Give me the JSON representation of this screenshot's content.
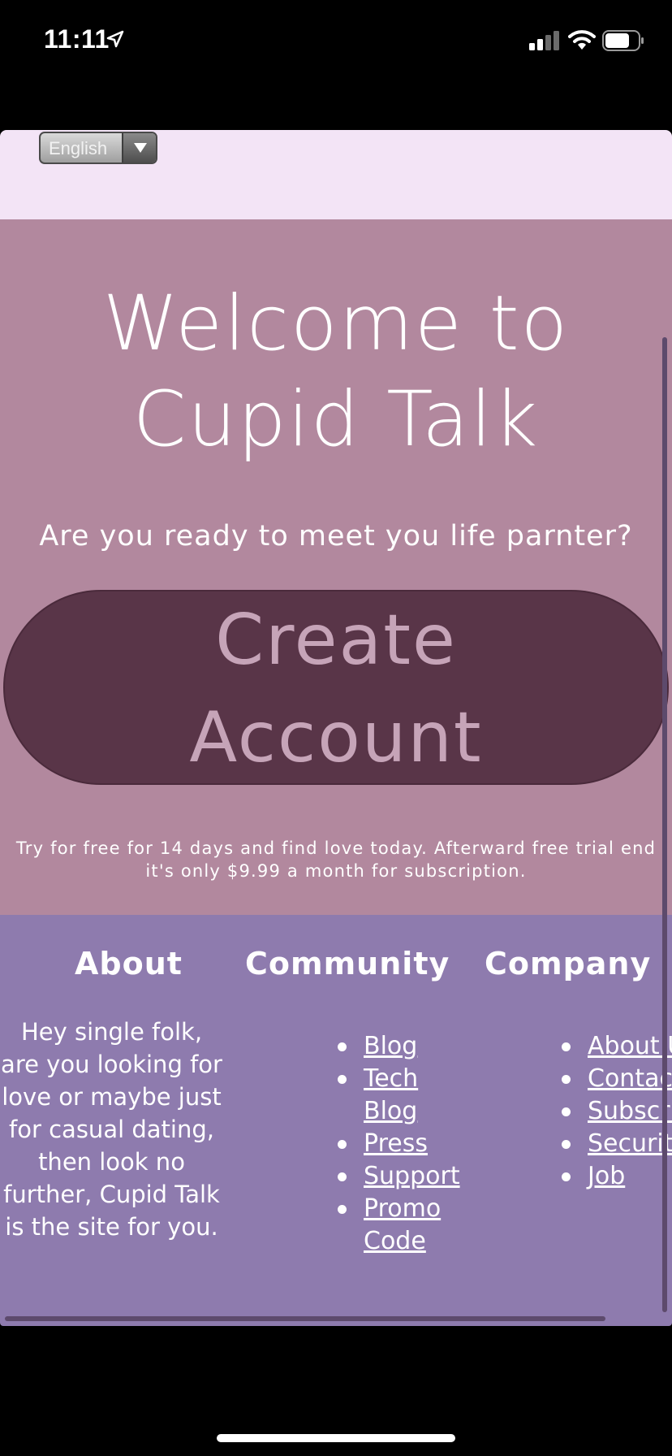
{
  "status": {
    "time": "11:11",
    "icons": [
      "location-arrow-icon",
      "cellular-signal-icon",
      "wifi-icon",
      "battery-icon"
    ]
  },
  "language": {
    "selected": "English"
  },
  "hero": {
    "title_line1": "Welcome to",
    "title_line2": "Cupid Talk",
    "subtitle": "Are you ready to meet you life parnter?",
    "cta_line1": "Create",
    "cta_line2": "Account",
    "trial_line1": "Try for free for 14 days and find love today. Afterward free trial end",
    "trial_line2": "it's only $9.99 a month for subscription."
  },
  "footer": {
    "about": {
      "heading": "About",
      "text": "Hey single folk, are you looking for love or maybe just for casual dating, then look no further, Cupid Talk is the site for you."
    },
    "community": {
      "heading": "Community",
      "links": [
        "Blog",
        "Tech Blog",
        "Press",
        "Support",
        "Promo Code"
      ]
    },
    "company": {
      "heading": "Company",
      "links": [
        "About Us",
        "Contact Us",
        "Subscription Tiers",
        "Security",
        "Job"
      ]
    }
  },
  "colors": {
    "lang_bar": "#f3e4f6",
    "hero_bg": "#b2889e",
    "cta_bg": "#593548",
    "cta_text": "#c6a4b8",
    "footer_bg": "#8e7bae"
  }
}
